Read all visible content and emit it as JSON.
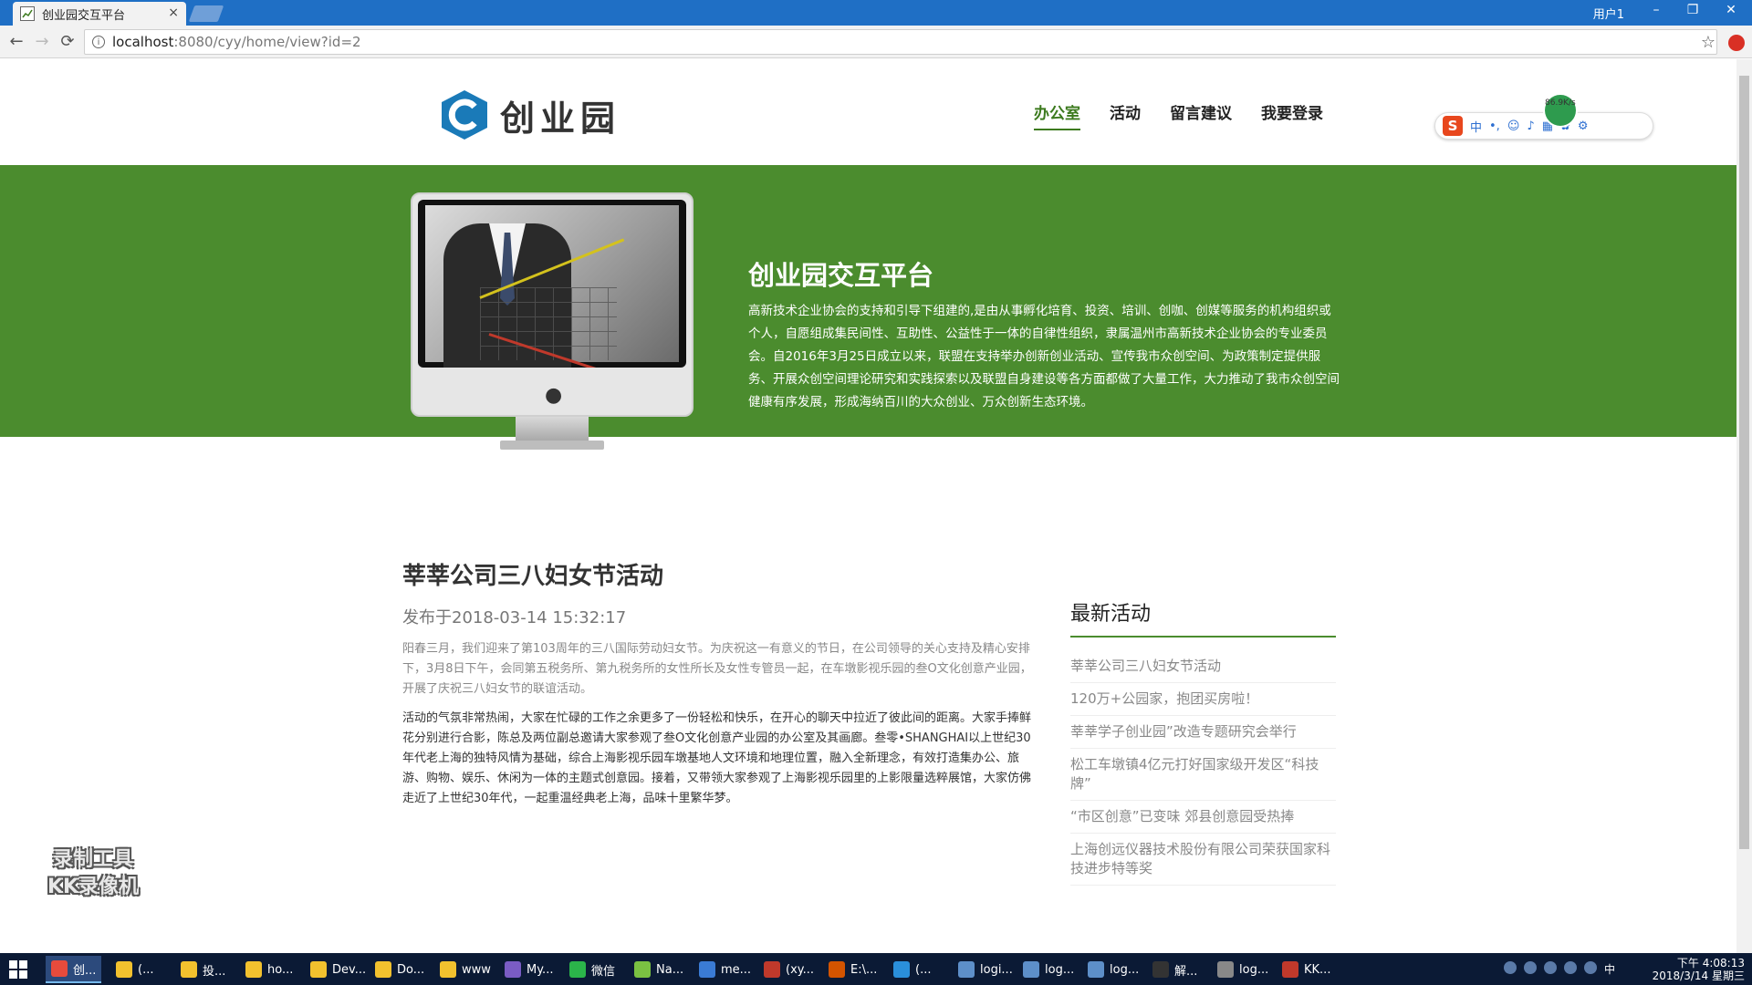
{
  "browser": {
    "tab_title": "创业园交互平台",
    "tab_close": "×",
    "user_label": "用户1",
    "minimize": "–",
    "restore": "❐",
    "close": "✕",
    "back": "←",
    "forward": "→",
    "reload": "⟳",
    "url_host": "localhost",
    "url_path": ":8080/cyy/home/view?id=2",
    "star": "☆"
  },
  "header": {
    "logo_text": "创业园",
    "nav": [
      "办公室",
      "活动",
      "留言建议",
      "我要登录"
    ],
    "active_nav": 0
  },
  "ime": {
    "logo": "S",
    "mode": "中",
    "punct": "•,",
    "speed": "86.9K/s"
  },
  "hero": {
    "title": "创业园交互平台",
    "text": "高新技术企业协会的支持和引导下组建的,是由从事孵化培育、投资、培训、创咖、创媒等服务的机构组织或个人，自愿组成集民间性、互助性、公益性于一体的自律性组织，隶属温州市高新技术企业协会的专业委员会。自2016年3月25日成立以来，联盟在支持举办创新创业活动、宣传我市众创空间、为政策制定提供服务、开展众创空间理论研究和实践探索以及联盟自身建设等各方面都做了大量工作，大力推动了我市众创空间健康有序发展，形成海纳百川的大众创业、万众创新生态环境。"
  },
  "article": {
    "title": "莘莘公司三八妇女节活动",
    "date": "发布于2018-03-14 15:32:17",
    "p1": "阳春三月，我们迎来了第103周年的三八国际劳动妇女节。为庆祝这一有意义的节日，在公司领导的关心支持及精心安排下，3月8日下午，会同第五税务所、第九税务所的女性所长及女性专管员一起，在车墩影视乐园的叁O文化创意产业园，开展了庆祝三八妇女节的联谊活动。",
    "p2": "活动的气氛非常热闹，大家在忙碌的工作之余更多了一份轻松和快乐，在开心的聊天中拉近了彼此间的距离。大家手捧鲜花分别进行合影，陈总及两位副总邀请大家参观了叁O文化创意产业园的办公室及其画廊。叁零•SHANGHAI以上世纪30年代老上海的独特风情为基础，综合上海影视乐园车墩基地人文环境和地理位置，融入全新理念，有效打造集办公、旅游、购物、娱乐、休闲为一体的主题式创意园。接着，又带领大家参观了上海影视乐园里的上影限量选粹展馆，大家仿佛走近了上世纪30年代，一起重温经典老上海，品味十里繁华梦。"
  },
  "sidebar": {
    "title": "最新活动",
    "items": [
      "莘莘公司三八妇女节活动",
      "120万+公园家，抱团买房啦！",
      "莘莘学子创业园”改造专题研究会举行",
      "松工车墩镇4亿元打好国家级开发区“科技牌”",
      "“市区创意”已变味 郊县创意园受热捧",
      "上海创远仪器技术股份有限公司荣获国家科技进步特等奖"
    ]
  },
  "watermark": {
    "line1": "录制工具",
    "line2": "KK录像机"
  },
  "taskbar": {
    "items": [
      "创...",
      "(...",
      "投...",
      "ho...",
      "Dev...",
      "Do...",
      "www",
      "My...",
      "微信",
      "Na...",
      "me...",
      "(xy...",
      "E:\\...",
      "(...",
      "logi...",
      "log...",
      "log...",
      "解...",
      "log...",
      "KK..."
    ],
    "time": "下午 4:08:13",
    "date": "2018/3/14 星期三",
    "ime_tray": "中"
  },
  "colors": {
    "brand_green": "#4b8c2e",
    "logo_blue": "#1a7ab8",
    "titlebar_blue": "#1f6fc5",
    "taskbar": "#0b1a35"
  }
}
